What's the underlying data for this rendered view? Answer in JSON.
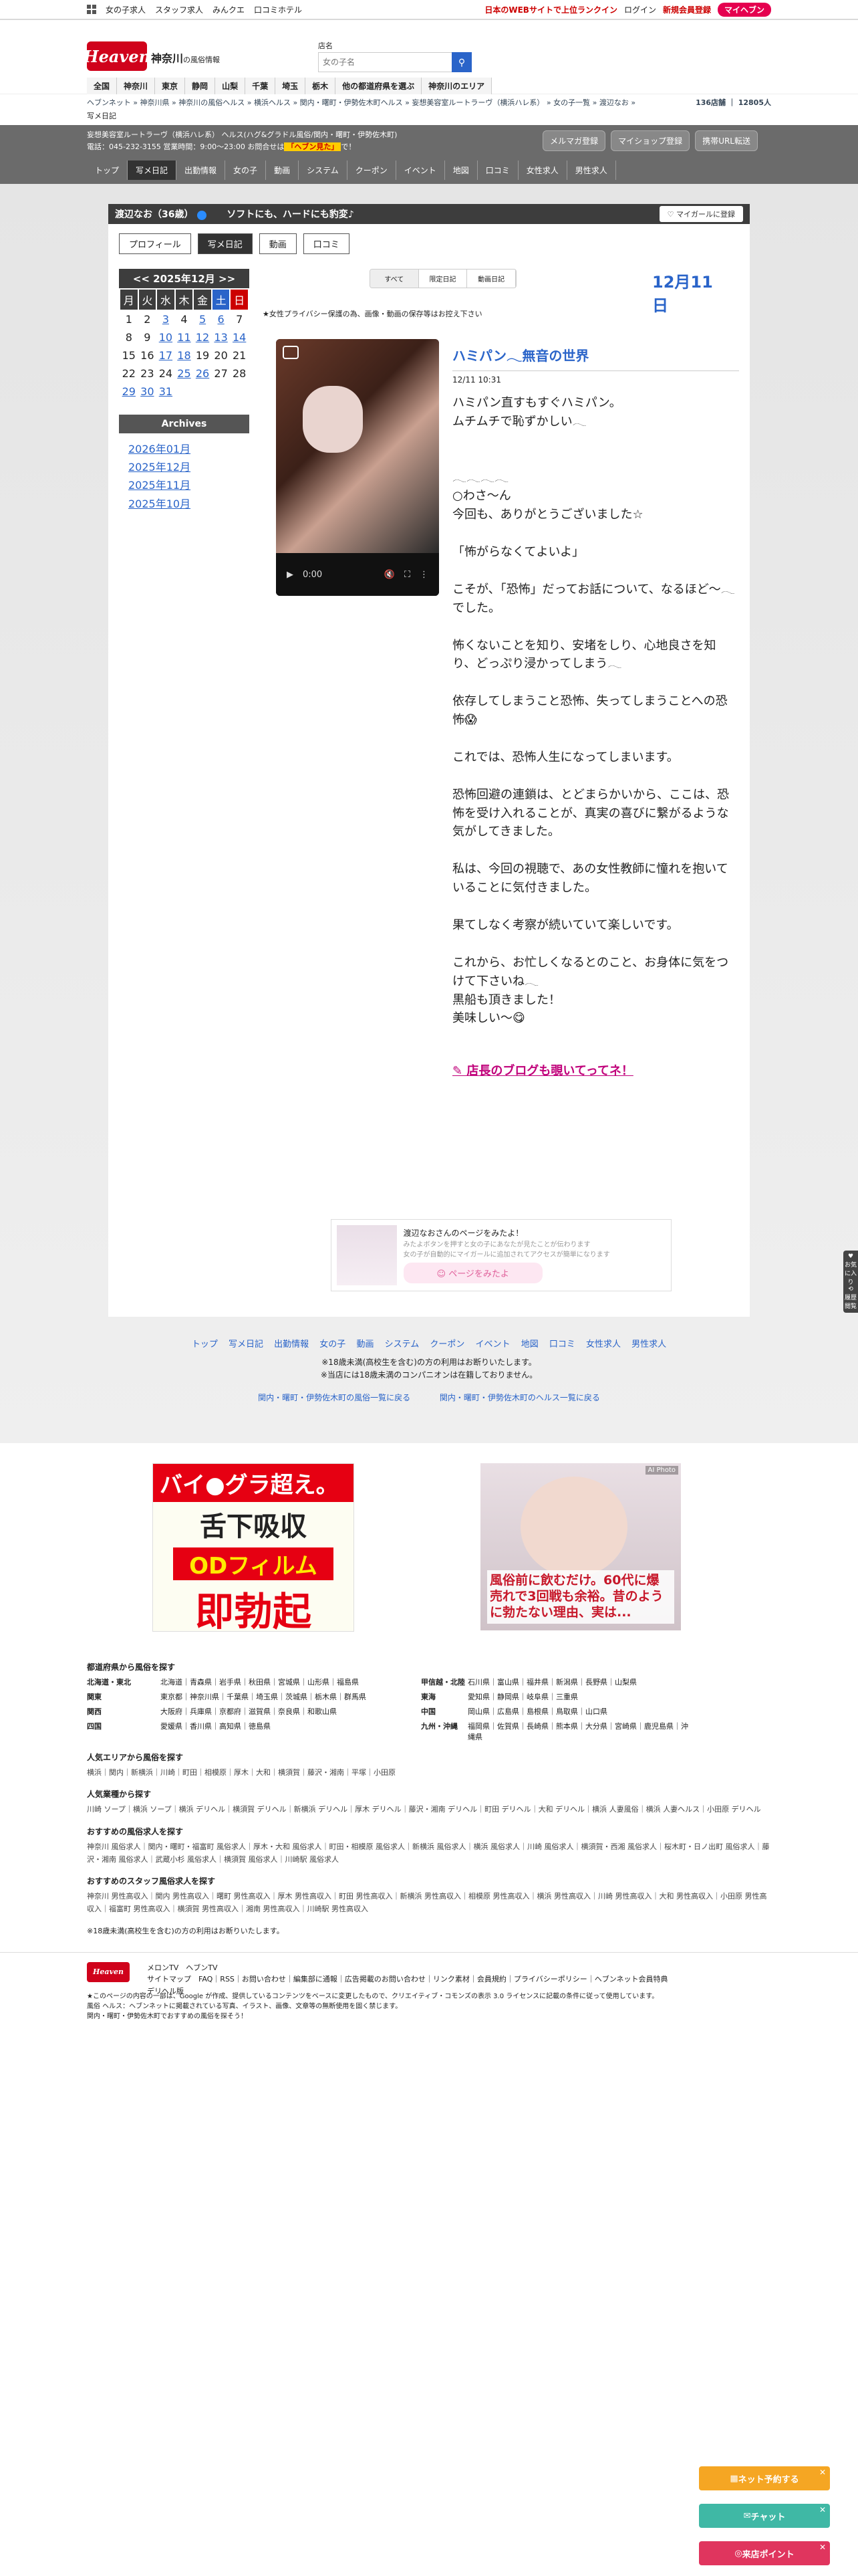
{
  "topstrip": {
    "links": [
      "女の子求人",
      "スタッフ求人",
      "みんクエ",
      "口コミホテル"
    ],
    "right_text": "日本のWEBサイトで上位ランクイン",
    "login": "ログイン",
    "register": "新規会員登録",
    "myheaven": "マイヘブン"
  },
  "header": {
    "logo": "Heaven",
    "region": "神奈川",
    "region_suffix": "の風俗情報",
    "search_label": "店名",
    "search_placeholder": "女の子名",
    "areas": [
      "全国",
      "神奈川",
      "東京",
      "静岡",
      "山梨",
      "千葉",
      "埼玉",
      "栃木",
      "他の都道府県を選ぶ",
      "神奈川のエリア"
    ]
  },
  "breadcrumb": {
    "path": "ヘブンネット » 神奈川県 » 神奈川の風俗ヘルス » 横浜ヘルス » 関内・曙町・伊勢佐木町ヘルス » 妄想美容室ルートラーヴ（横浜ハレ系） » 女の子一覧 » 渡辺なお »",
    "sub": "写メ日記",
    "count_shops": "136店舗",
    "count_people": "12805人"
  },
  "shop": {
    "line1": "妄想美容室ルートラーヴ（横浜ハレ系） ヘルス(ハグ&グラドル風俗/関内・曙町・伊勢佐木町)",
    "line2": "電話：045-232-3155 営業時間：9:00〜23:00 お問合せは",
    "line2_highlight": "「ヘブン見た」",
    "line2_end": "で！",
    "buttons": [
      "メルマガ登録",
      "マイショップ登録",
      "携帯URL転送"
    ],
    "nav": [
      "トップ",
      "写メ日記",
      "出勤情報",
      "女の子",
      "動画",
      "システム",
      "クーポン",
      "イベント",
      "地図",
      "口コミ",
      "女性求人",
      "男性求人"
    ]
  },
  "profile": {
    "name": "渡辺なお（36歳）",
    "catch": "ソフトにも、ハードにも豹変♪",
    "mygirl": "マイガールに登録",
    "tabs": [
      "プロフィール",
      "写メ日記",
      "動画",
      "口コミ"
    ]
  },
  "calendar": {
    "header": "<< 2025年12月 >>",
    "weekdays": [
      "月",
      "火",
      "水",
      "木",
      "金",
      "土",
      "日"
    ],
    "weeks": [
      [
        "1",
        "2",
        "3",
        "4",
        "5",
        "6",
        "7"
      ],
      [
        "8",
        "9",
        "10",
        "11",
        "12",
        "13",
        "14"
      ],
      [
        "15",
        "16",
        "17",
        "18",
        "19",
        "20",
        "21"
      ],
      [
        "22",
        "23",
        "24",
        "25",
        "26",
        "27",
        "28"
      ],
      [
        "29",
        "30",
        "31",
        "",
        "",
        "",
        ""
      ]
    ],
    "linked": [
      "3",
      "5",
      "6",
      "10",
      "11",
      "12",
      "13",
      "14",
      "17",
      "18",
      "25",
      "26",
      "29",
      "30",
      "31"
    ]
  },
  "archives": {
    "title": "Archives",
    "items": [
      "2026年01月",
      "2025年12月",
      "2025年11月",
      "2025年10月"
    ]
  },
  "filter": [
    "すべて",
    "限定日記",
    "動画日記"
  ],
  "date_big": "12月11日",
  "privacy": "★女性プライバシー保護の為、画像・動画の保存等はお控え下さい",
  "video": {
    "time": "0:00"
  },
  "post": {
    "title": "ハミパン𓂃無音の世界",
    "time": "12/11 10:31",
    "body": "ハミパン直すもすぐハミパン。\nムチムチで恥ずかしい𓂃\n\n\n𓂃𓂃𓂃𓂃\n○わさ〜ん\n今回も、ありがとうございました☆\n\n「怖がらなくてよいよ」\n\nこそが、「恐怖」だってお話について、なるほど〜𓂃でした。\n\n怖くないことを知り、安堵をしり、心地良さを知り、どっぷり浸かってしまう𓂃\n\n依存してしまうこと恐怖、失ってしまうことへの恐怖😱\n\nこれでは、恐怖人生になってしまいます。\n\n恐怖回避の連鎖は、とどまらかいから、ここは、恐怖を受け入れることが、真実の喜びに繋がるような気がしてきました。\n\n私は、今回の視聴で、あの女性教師に憧れを抱いていることに気付きました。\n\n果てしなく考察が続いていて楽しいです。\n\nこれから、お忙しくなるとのこと、お身体に気をつけて下さいね𓂃\n黒船も頂きました！\n美味しい〜😋",
    "shop_blog": "店長のブログも覗いてってネ！"
  },
  "promo": {
    "title": "渡辺なおさんのページをみたよ！",
    "sub1": "みたよボタンを押すと女の子にあなたが見たことが伝わります",
    "sub2": "女の子が自動的にマイガールに追加されてアクセスが簡単になります",
    "button": "ページをみたよ"
  },
  "footnav": [
    "トップ",
    "写メ日記",
    "出勤情報",
    "女の子",
    "動画",
    "システム",
    "クーポン",
    "イベント",
    "地図",
    "口コミ",
    "女性求人",
    "男性求人"
  ],
  "warn": [
    "※18歳未満(高校生を含む)の方の利用はお断りいたします。",
    "※当店には18歳未満のコンパニオンは在籍しておりません。"
  ],
  "back_links": [
    "関内・曙町・伊勢佐木町の風俗一覧に戻る",
    "関内・曙町・伊勢佐木町のヘルス一覧に戻る"
  ],
  "banner1": {
    "l1": "バイ●グラ超え。",
    "l2": "舌下吸収",
    "l3": "ODフィルム",
    "l4": "即勃起"
  },
  "banner2": {
    "tag": "AI Photo",
    "text": "風俗前に飲むだけ。60代に爆売れで3回戦も余裕。昔のように勃たない理由、実は..."
  },
  "pref_section": {
    "title": "都道府県から風俗を探す",
    "rows": [
      {
        "r": "北海道・東北",
        "p": "北海道｜青森県｜岩手県｜秋田県｜宮城県｜山形県｜福島県",
        "r2": "甲信越・北陸",
        "p2": "石川県｜富山県｜福井県｜新潟県｜長野県｜山梨県"
      },
      {
        "r": "関東",
        "p": "東京都｜神奈川県｜千葉県｜埼玉県｜茨城県｜栃木県｜群馬県",
        "r2": "東海",
        "p2": "愛知県｜静岡県｜岐阜県｜三重県"
      },
      {
        "r": "関西",
        "p": "大阪府｜兵庫県｜京都府｜滋賀県｜奈良県｜和歌山県",
        "r2": "中国",
        "p2": "岡山県｜広島県｜島根県｜鳥取県｜山口県"
      },
      {
        "r": "四国",
        "p": "愛媛県｜香川県｜高知県｜徳島県",
        "r2": "九州・沖縄",
        "p2": "福岡県｜佐賀県｜長崎県｜熊本県｜大分県｜宮崎県｜鹿児島県｜沖縄県"
      }
    ]
  },
  "popular_area": {
    "title": "人気エリアから風俗を探す",
    "line": "横浜｜関内｜新横浜｜川崎｜町田｜相模原｜厚木｜大和｜横須賀｜藤沢・湘南｜平塚｜小田原"
  },
  "popular_type": {
    "title": "人気業種から探す",
    "line": "川崎 ソープ｜横浜 ソープ｜横浜 デリヘル｜横須賀 デリヘル｜新横浜 デリヘル｜厚木 デリヘル｜藤沢・湘南 デリヘル｜町田 デリヘル｜大和 デリヘル｜横浜 人妻風俗｜横浜 人妻ヘルス｜小田原 デリヘル"
  },
  "rec_female": {
    "title": "おすすめの風俗求人を探す",
    "line": "神奈川 風俗求人｜関内・曙町・福富町 風俗求人｜厚木・大和 風俗求人｜町田・相模原 風俗求人｜新横浜 風俗求人｜横浜 風俗求人｜川崎 風俗求人｜横須賀・西湘 風俗求人｜桜木町・日ノ出町 風俗求人｜藤沢・湘南 風俗求人｜武蔵小杉 風俗求人｜横須賀 風俗求人｜川崎駅 風俗求人"
  },
  "rec_male": {
    "title": "おすすめのスタッフ風俗求人を探す",
    "line": "神奈川 男性高収入｜関内 男性高収入｜曙町 男性高収入｜厚木 男性高収入｜町田 男性高収入｜新横浜 男性高収入｜相模原 男性高収入｜横浜 男性高収入｜川崎 男性高収入｜大和 男性高収入｜小田原 男性高収入｜福富町 男性高収入｜横須賀 男性高収入｜湘南 男性高収入｜川崎駅 男性高収入"
  },
  "age_note": "※18歳未満(高校生を含む)の方の利用はお断りいたします。",
  "footer": {
    "logo": "Heaven",
    "sites": [
      "メロンTV",
      "ヘブンTV"
    ],
    "site_map_label": "サイトマップ",
    "device_label": "デリヘル版",
    "links": "FAQ｜RSS｜お問い合わせ｜編集部に通報｜広告掲載のお問い合わせ｜リンク素材｜会員規約｜プライバシーポリシー｜ヘブンネット会員特典",
    "copy1": "★このページの内容の一部は、Google が作成、提供しているコンテンツをベースに変更したもので、クリエイティブ・コモンズの表示 3.0 ライセンスに記載の条件に従って使用しています。",
    "copy2": "風俗 ヘルス：ヘブンネットに掲載されている写真、イラスト、画像、文章等の無断使用を固く禁じます。",
    "copy3": "関内・曙町・伊勢佐木町でおすすめの風俗を探そう！"
  },
  "floating": [
    "ネット予約する",
    "チャット",
    "来店ポイント"
  ],
  "side_icons": [
    "お気に入り",
    "履歴",
    "閲覧"
  ]
}
